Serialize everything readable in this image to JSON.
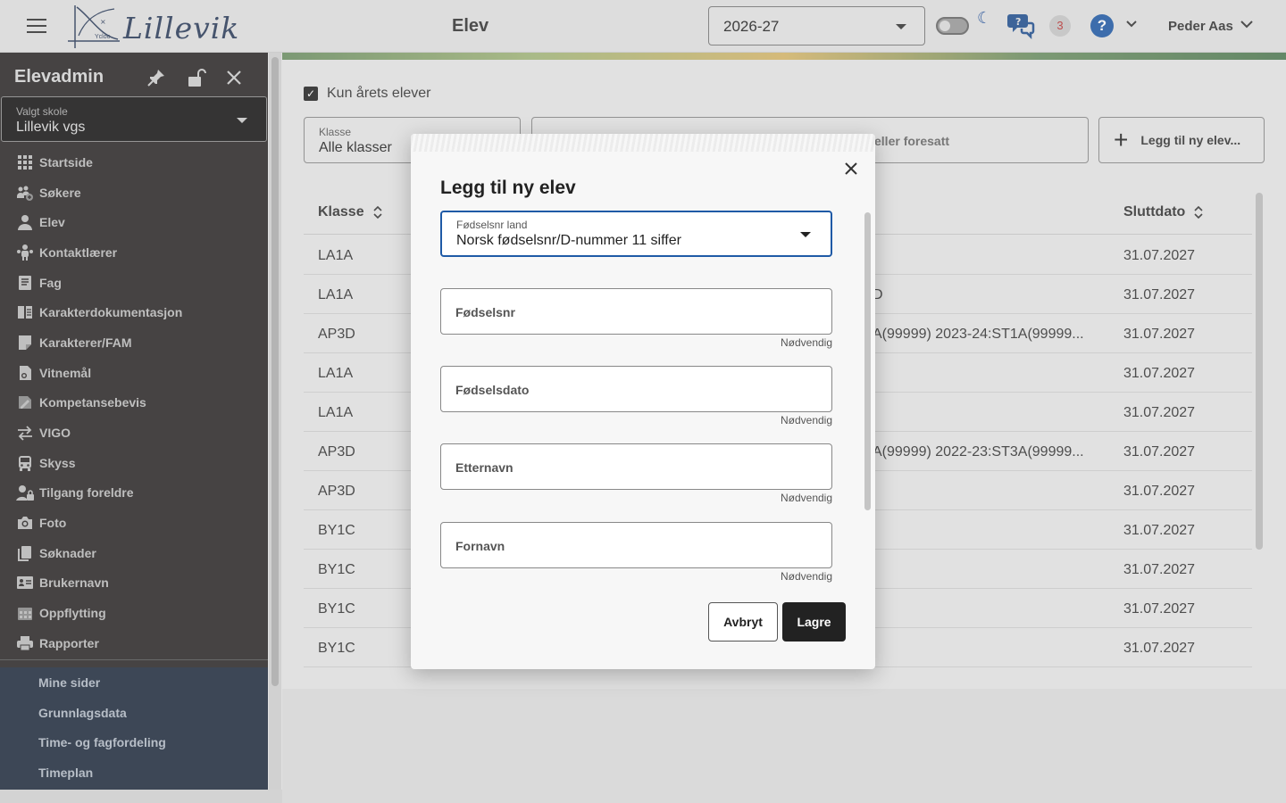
{
  "topbar": {
    "page_title": "Elev",
    "school_year": "2026-27",
    "notification_count": "3",
    "help_label": "?",
    "user_name": "Peder Aas",
    "logo_text": "Lillevik",
    "logo_caption": "Ycloo"
  },
  "sidebar": {
    "title": "Elevadmin",
    "school_select": {
      "label": "Valgt skole",
      "value": "Lillevik vgs"
    },
    "items": [
      {
        "label": "Startside",
        "icon": "grid-icon"
      },
      {
        "label": "Søkere",
        "icon": "people-add-icon"
      },
      {
        "label": "Elev",
        "icon": "person-icon"
      },
      {
        "label": "Kontaktlærer",
        "icon": "teacher-icon"
      },
      {
        "label": "Fag",
        "icon": "book-icon"
      },
      {
        "label": "Karakterdokumentasjon",
        "icon": "document-icon"
      },
      {
        "label": "Karakterer/FAM",
        "icon": "note-icon"
      },
      {
        "label": "Vitnemål",
        "icon": "diploma-icon"
      },
      {
        "label": "Kompetansebevis",
        "icon": "certificate-icon"
      },
      {
        "label": "VIGO",
        "icon": "swap-icon"
      },
      {
        "label": "Skyss",
        "icon": "bus-icon"
      },
      {
        "label": "Tilgang foreldre",
        "icon": "person-lock-icon"
      },
      {
        "label": "Foto",
        "icon": "camera-icon"
      },
      {
        "label": "Søknader",
        "icon": "copy-icon"
      },
      {
        "label": "Brukernavn",
        "icon": "id-card-icon"
      },
      {
        "label": "Oppflytting",
        "icon": "calendar-icon"
      },
      {
        "label": "Rapporter",
        "icon": "printer-icon"
      }
    ],
    "bottom_items": [
      {
        "label": "Mine sider"
      },
      {
        "label": "Grunnlagsdata"
      },
      {
        "label": "Time- og fagfordeling"
      },
      {
        "label": "Timeplan"
      }
    ]
  },
  "main": {
    "checkbox_label": "Kun årets elever",
    "klasse_select": {
      "label": "Klasse",
      "value": "Alle klasser"
    },
    "search_placeholder_visible": "eller foresatt",
    "add_button_label": "Legg til ny elev...",
    "table": {
      "headers": {
        "klasse": "Klasse",
        "sluttdato": "Sluttdato"
      },
      "rows": [
        {
          "klasse": "LA1A",
          "middle": "",
          "sluttdato": "31.07.2027"
        },
        {
          "klasse": "LA1A",
          "middle": "D",
          "sluttdato": "31.07.2027"
        },
        {
          "klasse": "AP3D",
          "middle": "A(99999) 2023-24:ST1A(99999...",
          "sluttdato": "31.07.2027"
        },
        {
          "klasse": "LA1A",
          "middle": "",
          "sluttdato": "31.07.2027"
        },
        {
          "klasse": "LA1A",
          "middle": "",
          "sluttdato": "31.07.2027"
        },
        {
          "klasse": "AP3D",
          "middle": "A(99999) 2022-23:ST3A(99999...",
          "sluttdato": "31.07.2027"
        },
        {
          "klasse": "AP3D",
          "middle": "",
          "sluttdato": "31.07.2027"
        },
        {
          "klasse": "BY1C",
          "middle": "",
          "sluttdato": "31.07.2027"
        },
        {
          "klasse": "BY1C",
          "middle": "",
          "sluttdato": "31.07.2027"
        },
        {
          "klasse": "BY1C",
          "middle": "",
          "sluttdato": "31.07.2027"
        },
        {
          "klasse": "BY1C",
          "middle": "",
          "sluttdato": "31.07.2027"
        }
      ]
    }
  },
  "modal": {
    "title": "Legg til ny elev",
    "country_select": {
      "label": "Fødselsnr land",
      "value": "Norsk fødselsnr/D-nummer 11 siffer"
    },
    "fields": [
      {
        "label": "Fødselsnr",
        "helper": "Nødvendig"
      },
      {
        "label": "Fødselsdato",
        "helper": "Nødvendig"
      },
      {
        "label": "Etternavn",
        "helper": "Nødvendig"
      },
      {
        "label": "Fornavn",
        "helper": "Nødvendig"
      }
    ],
    "cancel_label": "Avbryt",
    "save_label": "Lagre"
  },
  "colors": {
    "sidebar_bg": "#2a2726",
    "sidebar_bottom_bg": "#1f2b3d",
    "accent_blue": "#1f5aa6",
    "primary_button": "#222222"
  }
}
